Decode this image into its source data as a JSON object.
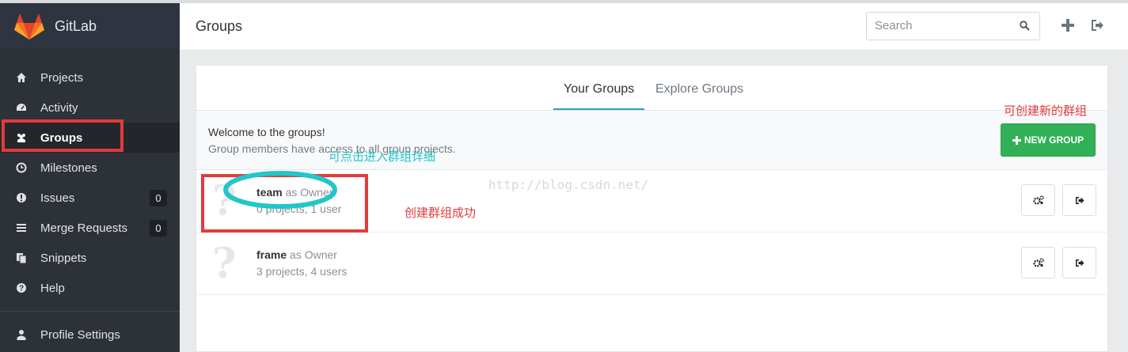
{
  "brand": {
    "name": "GitLab"
  },
  "sidebar": {
    "items": [
      {
        "label": "Projects",
        "icon": "home-icon"
      },
      {
        "label": "Activity",
        "icon": "dashboard-icon"
      },
      {
        "label": "Groups",
        "icon": "users-icon",
        "active": true
      },
      {
        "label": "Milestones",
        "icon": "clock-icon"
      },
      {
        "label": "Issues",
        "icon": "exclamation-circle-icon",
        "count": "0"
      },
      {
        "label": "Merge Requests",
        "icon": "list-icon",
        "count": "0"
      },
      {
        "label": "Snippets",
        "icon": "clipboard-icon"
      },
      {
        "label": "Help",
        "icon": "question-circle-icon"
      }
    ],
    "profile": {
      "label": "Profile Settings",
      "icon": "user-icon"
    }
  },
  "header": {
    "title": "Groups",
    "search_placeholder": "Search"
  },
  "tabs": [
    {
      "label": "Your Groups",
      "active": true
    },
    {
      "label": "Explore Groups",
      "active": false
    }
  ],
  "welcome": {
    "title": "Welcome to the groups!",
    "subtitle": "Group members have access to all group projects."
  },
  "new_group_label": "NEW GROUP",
  "groups": [
    {
      "name": "team",
      "role": "as Owner",
      "meta": "0 projects, 1 user"
    },
    {
      "name": "frame",
      "role": "as Owner",
      "meta": "3 projects, 4 users"
    }
  ],
  "annotations": {
    "new_group_note": "可创建新的群组",
    "click_note": "可点击进入群组详细",
    "success_note": "创建群组成功",
    "watermark": "http://blog.csdn.net/"
  },
  "colors": {
    "sidebar_bg": "#2d3238",
    "accent_tab": "#2d9dba",
    "new_group_green": "#31b057",
    "annotation_red": "#e23b3b",
    "annotation_cyan": "#22c6c9"
  }
}
